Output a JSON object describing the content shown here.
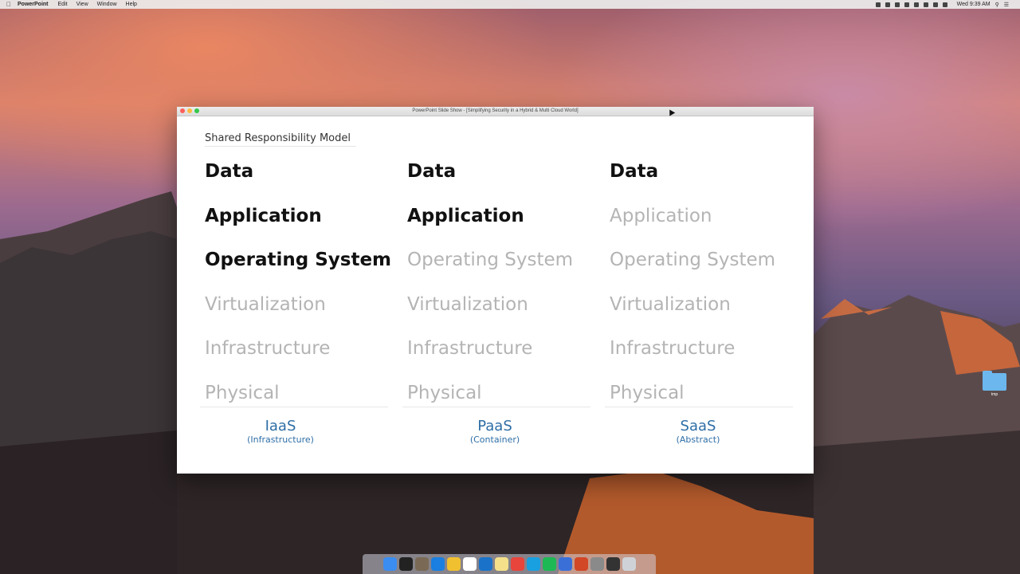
{
  "menubar": {
    "app_name": "PowerPoint",
    "menus": [
      "Edit",
      "View",
      "Window",
      "Help"
    ],
    "clock": "Wed 9:39 AM"
  },
  "window": {
    "title": "PowerPoint Slide Show - [Simplifying Security in a Hybrid & Multi Cloud World]"
  },
  "slide": {
    "subtitle": "Shared Responsibility Model",
    "columns": [
      {
        "rows": [
          {
            "label": "Data",
            "active": true
          },
          {
            "label": "Application",
            "active": true
          },
          {
            "label": "Operating System",
            "active": true
          },
          {
            "label": "Virtualization",
            "active": false
          },
          {
            "label": "Infrastructure",
            "active": false
          },
          {
            "label": "Physical",
            "active": false
          }
        ],
        "model": "IaaS",
        "model_desc": "(Infrastructure)"
      },
      {
        "rows": [
          {
            "label": "Data",
            "active": true
          },
          {
            "label": "Application",
            "active": true
          },
          {
            "label": "Operating System",
            "active": false
          },
          {
            "label": "Virtualization",
            "active": false
          },
          {
            "label": "Infrastructure",
            "active": false
          },
          {
            "label": "Physical",
            "active": false
          }
        ],
        "model": "PaaS",
        "model_desc": "(Container)"
      },
      {
        "rows": [
          {
            "label": "Data",
            "active": true
          },
          {
            "label": "Application",
            "active": false
          },
          {
            "label": "Operating System",
            "active": false
          },
          {
            "label": "Virtualization",
            "active": false
          },
          {
            "label": "Infrastructure",
            "active": false
          },
          {
            "label": "Physical",
            "active": false
          }
        ],
        "model": "SaaS",
        "model_desc": "(Abstract)"
      }
    ],
    "colors": {
      "active": "#111111",
      "inactive": "#b4b4b4",
      "model": "#2e6ea6"
    }
  },
  "desktop": {
    "folder_label": "tmp"
  },
  "dock": {
    "apps": [
      "finder-icon",
      "terminal-icon",
      "preview-icon",
      "safari-icon",
      "photos-icon",
      "calendar-icon",
      "outlook-icon",
      "notes-icon",
      "chrome-icon",
      "skype-icon",
      "spotify-icon",
      "keynote-icon",
      "powerpoint-icon",
      "settings-icon",
      "activity-icon",
      "trash-icon"
    ]
  }
}
